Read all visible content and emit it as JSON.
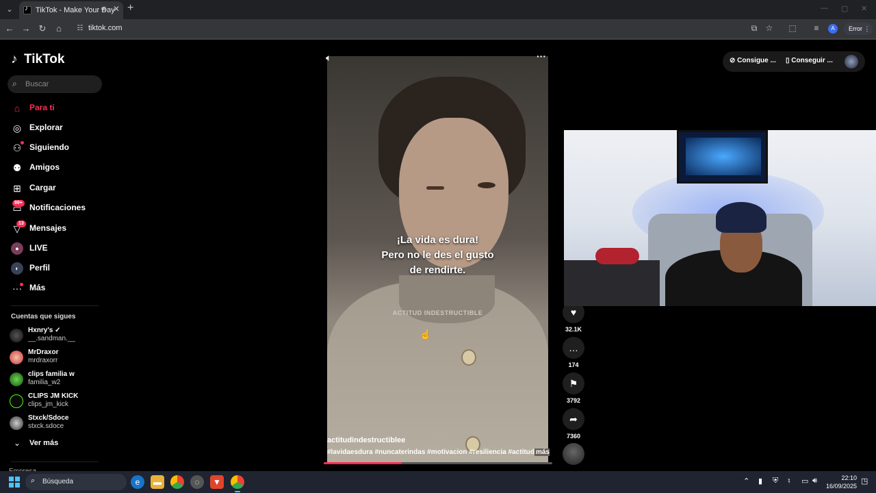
{
  "browser": {
    "tab_title": "TikTok - Make Your Day",
    "url": "tiktok.com",
    "profile_initial": "A",
    "error_label": "Error"
  },
  "sidebar": {
    "logo": "TikTok",
    "search_placeholder": "Buscar",
    "nav": [
      {
        "label": "Para ti",
        "icon": "home-icon",
        "active": true
      },
      {
        "label": "Explorar",
        "icon": "compass-icon"
      },
      {
        "label": "Siguiendo",
        "icon": "following-icon"
      },
      {
        "label": "Amigos",
        "icon": "friends-icon"
      },
      {
        "label": "Cargar",
        "icon": "upload-icon"
      },
      {
        "label": "Notificaciones",
        "icon": "inbox-icon",
        "badge": "99+"
      },
      {
        "label": "Mensajes",
        "icon": "messages-icon",
        "badge": "13"
      },
      {
        "label": "LIVE",
        "icon": "live-icon"
      },
      {
        "label": "Perfil",
        "icon": "profile-icon"
      },
      {
        "label": "Más",
        "icon": "more-icon"
      }
    ],
    "following_title": "Cuentas que sigues",
    "following": [
      {
        "name": "Hxnry's ✓",
        "handle": "__.sandman.__"
      },
      {
        "name": "MrDraxor",
        "handle": "mrdraxorr"
      },
      {
        "name": "clips familia w",
        "handle": "familia_w2"
      },
      {
        "name": "CLIPS JM KICK",
        "handle": "clips_jm_kick"
      },
      {
        "name": "Stxck/Sdoce",
        "handle": "stxck.sdoce"
      }
    ],
    "see_more": "Ver más",
    "company": "Empresa"
  },
  "video": {
    "caption_lines": [
      "¡La vida es dura!",
      "Pero no le des el gusto",
      "de rendirte."
    ],
    "watermark": "ACTITUD INDESTRUCTIBLE",
    "username": "actitudindestructiblee",
    "hashtags": "#lavidaesdura  #nuncaterindas  #motivacion  #resiliencia  #actitud ...",
    "more_label": "más",
    "progress": 0.34
  },
  "actions": {
    "likes": "32.1K",
    "comments": "174",
    "saves": "3792",
    "shares": "7360"
  },
  "top_right": {
    "pill1": "Consigue ...",
    "pill2": "Conseguir ..."
  },
  "taskbar": {
    "search_placeholder": "Búsqueda",
    "time": "22:10",
    "date": "16/09/2025"
  }
}
